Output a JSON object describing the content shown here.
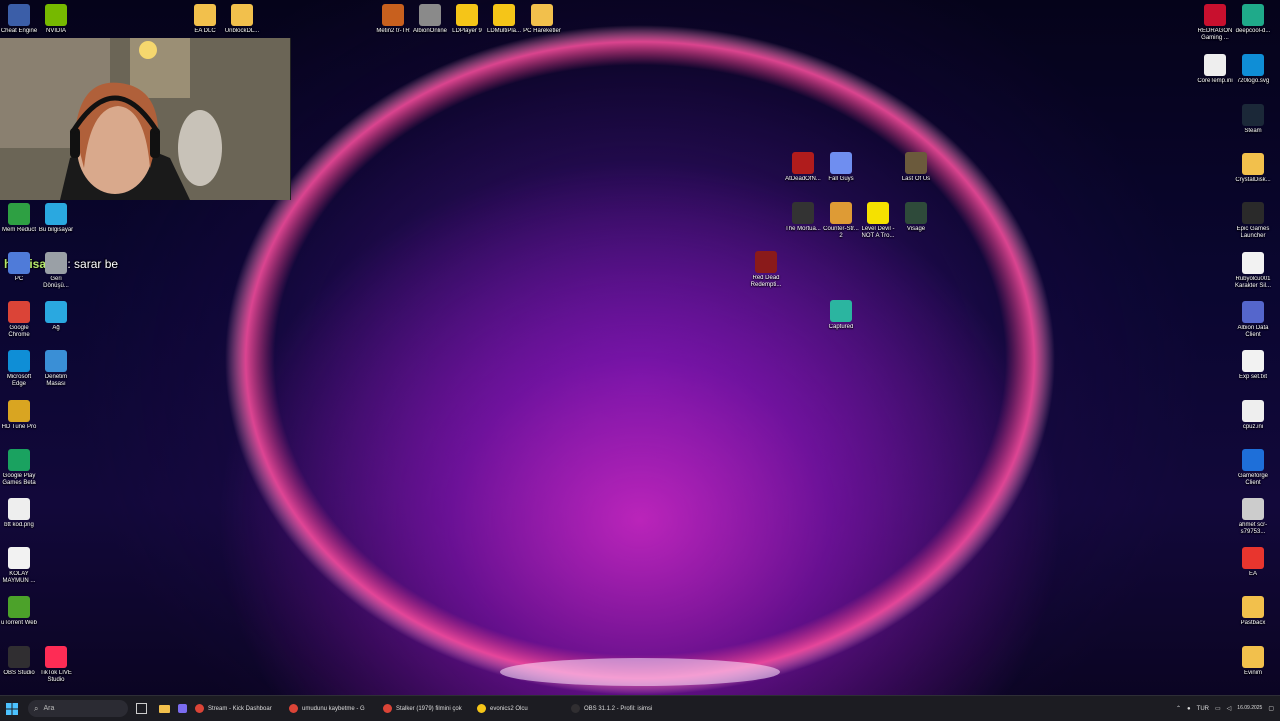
{
  "desktop_icons": {
    "left": [
      {
        "label": "Cheat Engine",
        "icon": "cheat-engine-icon",
        "color": "#3b5ea8"
      },
      {
        "label": "NVIDIA",
        "icon": "nvidia-icon",
        "color": "#76b900"
      },
      {
        "label": "Mem Reduct",
        "icon": "mem-reduct-icon",
        "color": "#2ea043"
      },
      {
        "label": "Bu bilgisayar",
        "icon": "computer-icon",
        "color": "#2aa8e0"
      },
      {
        "label": "PC",
        "icon": "pc-icon",
        "color": "#4f7bd9"
      },
      {
        "label": "Geri Dönüşü...",
        "icon": "recycle-bin-icon",
        "color": "#9aa0a6"
      },
      {
        "label": "Google Chrome",
        "icon": "chrome-icon",
        "color": "#db4437"
      },
      {
        "label": "Ağ",
        "icon": "network-icon",
        "color": "#2aa8e0"
      },
      {
        "label": "Microsoft Edge",
        "icon": "edge-icon",
        "color": "#0f8ed6"
      },
      {
        "label": "Denetim Masası",
        "icon": "control-panel-icon",
        "color": "#3a8fd6"
      },
      {
        "label": "HD Tune Pro",
        "icon": "hd-tune-icon",
        "color": "#d9a521"
      },
      {
        "label": "Google Play Games Beta",
        "icon": "play-games-icon",
        "color": "#1aa260"
      },
      {
        "label": "btt kod.png",
        "icon": "image-file-icon",
        "color": "#eeeeee"
      },
      {
        "label": "KOLAY MAYMUN ...",
        "icon": "text-file-icon",
        "color": "#f2f2f2"
      },
      {
        "label": "uTorrent Web",
        "icon": "utorrent-icon",
        "color": "#4ca22a"
      },
      {
        "label": "OBS Studio",
        "icon": "obs-icon",
        "color": "#302e31"
      },
      {
        "label": "TikTok LIVE Studio",
        "icon": "tiktok-icon",
        "color": "#fe2c55"
      }
    ],
    "top": [
      {
        "label": "EA DLC",
        "icon": "folder-icon",
        "color": "#f2c04c"
      },
      {
        "label": "UnblockDL...",
        "icon": "folder-icon",
        "color": "#f2c04c"
      },
      {
        "label": "Metin2 tr-TR",
        "icon": "metin2-icon",
        "color": "#c8601e"
      },
      {
        "label": "AlbionOnline",
        "icon": "albion-icon",
        "color": "#8a8a8a"
      },
      {
        "label": "LDPlayer 9",
        "icon": "ldplayer-icon",
        "color": "#f5c518"
      },
      {
        "label": "LDMultiPla...",
        "icon": "ldmultiplayer-icon",
        "color": "#f5c518"
      },
      {
        "label": "PC Hareketler",
        "icon": "folder-icon",
        "color": "#f2c04c"
      }
    ],
    "center": [
      {
        "label": "AtDeadOfN...",
        "icon": "at-dead-of-night-icon",
        "color": "#b01c1c"
      },
      {
        "label": "Fall Guys",
        "icon": "fall-guys-icon",
        "color": "#6f8ef0"
      },
      {
        "label": "Last Of Us",
        "icon": "last-of-us-icon",
        "color": "#6b5a3c"
      },
      {
        "label": "The Mortua...",
        "icon": "mortuary-icon",
        "color": "#333333"
      },
      {
        "label": "Counter-Str... 2",
        "icon": "counter-strike-icon",
        "color": "#de9b35"
      },
      {
        "label": "Level Devil - NOT A Tro...",
        "icon": "level-devil-icon",
        "color": "#f5e100"
      },
      {
        "label": "Visage",
        "icon": "visage-icon",
        "color": "#2e4a3a"
      },
      {
        "label": "Red Dead Redempti...",
        "icon": "red-dead-icon",
        "color": "#8a1a1a"
      },
      {
        "label": "Captured",
        "icon": "captured-icon",
        "color": "#2bb5a0"
      }
    ],
    "right": [
      {
        "label": "REDRAGON Gaming ...",
        "icon": "redragon-icon",
        "color": "#c8102e"
      },
      {
        "label": "deepcool-d...",
        "icon": "deepcool-icon",
        "color": "#1faa8a"
      },
      {
        "label": "CoreTemp.ini",
        "icon": "ini-file-icon",
        "color": "#eeeeee"
      },
      {
        "label": "720logo.svg",
        "icon": "edge-icon",
        "color": "#0f8ed6"
      },
      {
        "label": "Steam",
        "icon": "steam-icon",
        "color": "#1b2838"
      },
      {
        "label": "CrystalDisk...",
        "icon": "folder-icon",
        "color": "#f2c04c"
      },
      {
        "label": "Epic Games Launcher",
        "icon": "epic-games-icon",
        "color": "#2a2a2a"
      },
      {
        "label": "Rubyolcu001 Karakter Sil...",
        "icon": "text-file-icon",
        "color": "#f2f2f2"
      },
      {
        "label": "Albion Data Client",
        "icon": "albion-data-icon",
        "color": "#5566cc"
      },
      {
        "label": "Exp set.txt",
        "icon": "text-file-icon",
        "color": "#f2f2f2"
      },
      {
        "label": "cpuz.ini",
        "icon": "ini-file-icon",
        "color": "#eeeeee"
      },
      {
        "label": "Gameforge Client",
        "icon": "gameforge-icon",
        "color": "#1e6fd9"
      },
      {
        "label": "ahmet scr-s79753...",
        "icon": "image-file-icon",
        "color": "#cccccc"
      },
      {
        "label": "EA",
        "icon": "ea-icon",
        "color": "#e8352e"
      },
      {
        "label": "Pastbacx",
        "icon": "folder-icon",
        "color": "#f2c04c"
      },
      {
        "label": "Evinim",
        "icon": "folder-icon",
        "color": "#f2c04c"
      }
    ]
  },
  "chat_overlay": {
    "username": "hayrisahin",
    "message": " : sarar be"
  },
  "taskbar": {
    "search_placeholder": "Ara",
    "apps": [
      {
        "label": "Stream - Kick Dashboar",
        "icon": "chrome-icon",
        "color": "#db4437"
      },
      {
        "label": "umudunu kaybetme - G",
        "icon": "chrome-icon",
        "color": "#db4437"
      },
      {
        "label": "Stalker (1979) filmini çok",
        "icon": "chrome-icon",
        "color": "#db4437"
      },
      {
        "label": "evonics2 Olcu",
        "icon": "app-icon",
        "color": "#f5c518"
      },
      {
        "label": "OBS 31.1.2 - Profil: isimsi",
        "icon": "obs-icon",
        "color": "#302e31"
      }
    ],
    "language": "TUR",
    "date": "16.09.2025"
  }
}
